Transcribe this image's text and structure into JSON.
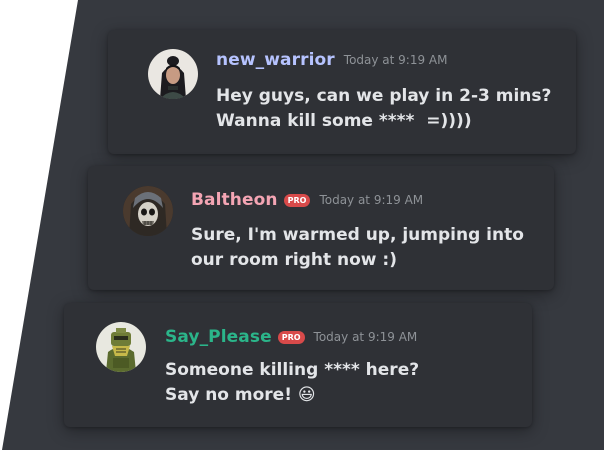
{
  "colors": {
    "panel_bg": "#36393f",
    "card_bg": "#2f3136",
    "pro_badge": "#d84a4a",
    "timestamp": "#8e9297",
    "message_text": "#e3e5e8"
  },
  "messages": [
    {
      "username": "new_warrior",
      "username_color": "#b6c3ff",
      "badge": "",
      "timestamp": "Today at 9:19 AM",
      "lines": [
        "Hey guys, can we play in 2-3 mins?",
        "Wanna kill some ****  =))))"
      ],
      "avatar_icon": "female-warrior-avatar"
    },
    {
      "username": "Baltheon",
      "username_color": "#f4a5b4",
      "badge": "PRO",
      "timestamp": "Today at 9:19 AM",
      "lines": [
        "Sure, I'm warmed up, jumping into",
        "our room right now :)"
      ],
      "avatar_icon": "skull-mask-avatar"
    },
    {
      "username": "Say_Please",
      "username_color": "#2bb58a",
      "badge": "PRO",
      "timestamp": "Today at 9:19 AM",
      "lines": [
        "Someone killing **** here?",
        "Say no more! "
      ],
      "emoji": "😃",
      "avatar_icon": "armored-soldier-avatar"
    }
  ]
}
